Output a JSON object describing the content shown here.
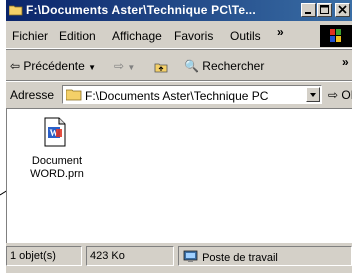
{
  "window": {
    "title": "F:\\Documents Aster\\Technique PC\\Te...",
    "buttons": [
      "minimize",
      "maximize",
      "close"
    ]
  },
  "menu": {
    "items": [
      "Fichier",
      "Edition",
      "Affichage",
      "Favoris",
      "Outils"
    ],
    "more": "»"
  },
  "toolbar": {
    "back_label": "Précédente",
    "search_label": "Rechercher",
    "more": "»"
  },
  "address": {
    "label": "Adresse",
    "path": "F:\\Documents Aster\\Technique PC",
    "go_label": "OK"
  },
  "content": {
    "file": {
      "name_line1": "Document",
      "name_line2": "WORD.prn"
    }
  },
  "status": {
    "objects": "1 objet(s)",
    "size": "423 Ko",
    "zone": "Poste de travail"
  },
  "icons": [
    "folder-icon",
    "minimize-icon",
    "maximize-icon",
    "close-icon",
    "windows-logo-icon",
    "back-arrow-icon",
    "forward-arrow-icon",
    "up-folder-icon",
    "search-icon",
    "go-arrow-icon",
    "word-document-icon",
    "computer-icon"
  ]
}
